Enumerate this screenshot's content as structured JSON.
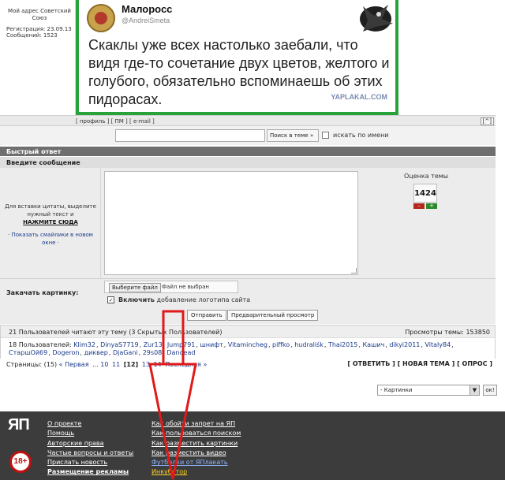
{
  "user_info": {
    "country": "Мой адрес Советский Союз",
    "registration": "Регистрация: 23.09.13",
    "posts": "Сообщений: 1523"
  },
  "tweet": {
    "name": "Малоросс",
    "handle": "@AndreiSmeta",
    "text": "Скаклы уже всех настолько заебали, что видя где-то сочетание двух цветов, желтого и голубого, обязательно вспоминаешь об этих пидорасах.",
    "watermark": "YAPLAKAL.COM"
  },
  "profile_links": "[ профиль ] [ ПМ ] [ e-mail ]",
  "up_button": "[^]",
  "search": {
    "button": "Поиск в теме »",
    "checkbox_label": "искать по имени"
  },
  "quick_reply": {
    "title": "Быстрый ответ",
    "subtitle": "Введите сообщение",
    "hint": "Для вставки цитаты, выделите нужный текст и",
    "hint_action": "НАЖМИТЕ СЮДА",
    "smiles": "Показать смайлики в новом окне",
    "rating_title": "Оценка темы",
    "rating_value": "1424",
    "rating_minus": "–",
    "rating_plus": "+",
    "upload_label": "Закачать картинку:",
    "file_button": "Выберите файл",
    "file_status": "Файл не выбран",
    "logo_strong": "Включить",
    "logo_rest": "добавление логотипа сайта",
    "send": "Отправить",
    "preview": "Предварительный просмотр"
  },
  "readers": {
    "count": "21 Пользователей читают эту тему (3 Скрытых Пользователей)",
    "views": "Просмотры темы: 153850",
    "users_prefix": "18 Пользователей:",
    "users": [
      "Klim32",
      "DinyaS7719",
      "Zur13",
      "Jump791",
      "шнифт",
      "Vitamincheg",
      "piffko",
      "hudraliśk",
      "Thai2015",
      "Кашич",
      "dikyi2011",
      "Vitaly84",
      "СтаршОй69",
      "Dogeron",
      "диквер",
      "DjaGani",
      "29s08",
      "Dandead"
    ]
  },
  "pager": {
    "label": "Страницы:",
    "count": "(15)",
    "first": "« Первая",
    "dots": "...",
    "pages": [
      "10",
      "11",
      "[12]",
      "13",
      "14"
    ],
    "last": "Последняя »",
    "actions": "[ ОТВЕТИТЬ ] [ НОВАЯ ТЕМА ] [ ОПРОС ]"
  },
  "forum_select": {
    "value": "- Картинки",
    "ok": "ок!"
  },
  "footer": {
    "logo": "ЯП",
    "age": "18+",
    "col1": [
      "О проекте",
      "Помощь",
      "Авторские права",
      "Частые вопросы и ответы",
      "Прислать новость",
      "Размещение рекламы"
    ],
    "col2": [
      "Как обойти запрет на ЯП",
      "Как пользоваться поиском",
      "Как разместить картинки",
      "Как разместить видео",
      "Футболки от ЯПлакать",
      "Инкубатор"
    ]
  }
}
